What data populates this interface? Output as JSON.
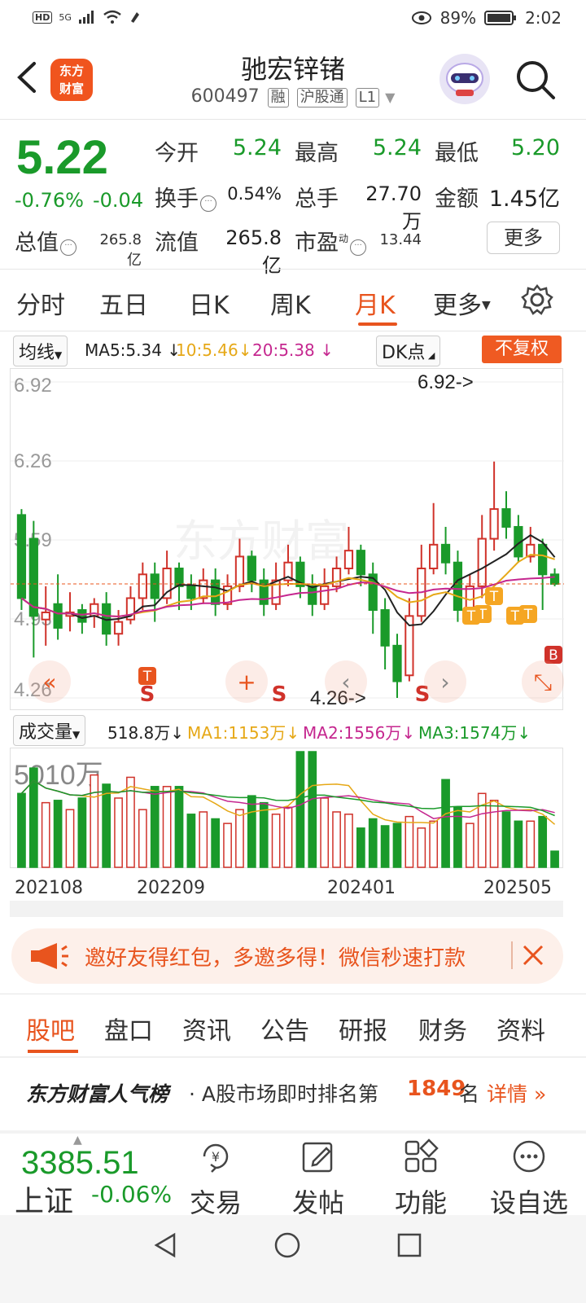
{
  "status": {
    "hd": "HD",
    "net": "5G",
    "battery": "89%",
    "time": "2:02"
  },
  "header": {
    "title": "驰宏锌锗",
    "code": "600497",
    "tags": [
      "融",
      "沪股通",
      "L1"
    ],
    "logo": "东方财富"
  },
  "quote": {
    "price": "5.22",
    "change_pct": "-0.76%",
    "change": "-0.04",
    "open_label": "今开",
    "open": "5.24",
    "high_label": "最高",
    "high": "5.24",
    "low_label": "最低",
    "low": "5.20",
    "turnover_label": "换手",
    "turnover": "0.54%",
    "volume_label": "总手",
    "volume": "27.70万",
    "amount_label": "金额",
    "amount": "1.45亿",
    "mktcap_label": "总值",
    "mktcap": "265.8亿",
    "float_label": "流值",
    "float_cap": "265.8亿",
    "pe_label": "市盈",
    "pe_sup": "动",
    "pe": "13.44",
    "more_button": "更多"
  },
  "tabs": [
    {
      "label": "分时"
    },
    {
      "label": "五日"
    },
    {
      "label": "日K"
    },
    {
      "label": "周K"
    },
    {
      "label": "月K",
      "active": true
    },
    {
      "label": "更多"
    }
  ],
  "ma_row": {
    "select": "均线",
    "ma5": "MA5:5.34",
    "ma10": "10:5.46",
    "ma20": "20:5.38",
    "dk": "DK点",
    "fuquan": "不复权"
  },
  "kchart": {
    "y_labels": [
      "6.92",
      "6.26",
      "5.59",
      "4.93",
      "4.26"
    ],
    "high_annot": "6.92->",
    "low_annot": "4.26->",
    "signals": {
      "t": "T",
      "s": "S",
      "b": "B"
    }
  },
  "vol_row": {
    "select": "成交量",
    "vol": "518.8万",
    "ma1": "MA1:1153万",
    "ma2": "MA2:1556万",
    "ma3": "MA3:1574万",
    "max_label": "5010万"
  },
  "x_labels": [
    "202108",
    "202209",
    "202401",
    "202505"
  ],
  "colors": {
    "up": "#d0322a",
    "down": "#1a9a2a",
    "accent": "#e8541e"
  },
  "chart_data": {
    "type": "candlestick",
    "ylim": [
      4.26,
      6.92
    ],
    "candles": [
      [
        5.8,
        5.1,
        5.85,
        5.0
      ],
      [
        5.6,
        4.95,
        5.75,
        4.6
      ],
      [
        4.92,
        4.98,
        5.2,
        4.7
      ],
      [
        5.05,
        4.85,
        5.3,
        4.75
      ],
      [
        4.95,
        4.98,
        5.15,
        4.82
      ],
      [
        5.0,
        4.9,
        5.05,
        4.8
      ],
      [
        4.95,
        5.05,
        5.1,
        4.85
      ],
      [
        5.05,
        4.8,
        5.15,
        4.7
      ],
      [
        4.8,
        4.9,
        5.0,
        4.7
      ],
      [
        4.92,
        5.1,
        5.2,
        4.88
      ],
      [
        5.1,
        5.3,
        5.4,
        5.0
      ],
      [
        5.3,
        5.1,
        5.4,
        4.9
      ],
      [
        5.1,
        5.35,
        5.5,
        5.05
      ],
      [
        5.35,
        5.2,
        5.4,
        5.0
      ],
      [
        5.2,
        5.1,
        5.3,
        5.0
      ],
      [
        5.1,
        5.25,
        5.35,
        5.05
      ],
      [
        5.25,
        5.05,
        5.35,
        4.95
      ],
      [
        5.05,
        5.2,
        5.3,
        5.0
      ],
      [
        5.2,
        5.45,
        5.6,
        5.15
      ],
      [
        5.45,
        5.25,
        5.5,
        5.15
      ],
      [
        5.25,
        5.05,
        5.35,
        4.95
      ],
      [
        5.05,
        5.25,
        5.4,
        5.0
      ],
      [
        5.25,
        5.4,
        5.55,
        5.2
      ],
      [
        5.4,
        5.2,
        5.45,
        5.1
      ],
      [
        5.2,
        5.05,
        5.3,
        4.95
      ],
      [
        5.05,
        5.2,
        5.35,
        5.0
      ],
      [
        5.2,
        5.35,
        5.45,
        5.15
      ],
      [
        5.35,
        5.5,
        5.7,
        5.3
      ],
      [
        5.5,
        5.3,
        5.55,
        5.2
      ],
      [
        5.3,
        5.0,
        5.4,
        4.8
      ],
      [
        5.0,
        4.7,
        5.1,
        4.5
      ],
      [
        4.7,
        4.4,
        4.8,
        4.26
      ],
      [
        4.45,
        4.95,
        5.1,
        4.4
      ],
      [
        4.95,
        5.35,
        5.55,
        4.9
      ],
      [
        5.35,
        5.55,
        5.9,
        5.3
      ],
      [
        5.55,
        5.4,
        5.7,
        5.3
      ],
      [
        5.4,
        5.0,
        5.5,
        4.9
      ],
      [
        5.0,
        5.2,
        5.3,
        4.9
      ],
      [
        5.2,
        5.6,
        5.8,
        5.1
      ],
      [
        5.6,
        5.85,
        6.25,
        5.5
      ],
      [
        5.85,
        5.7,
        6.0,
        5.6
      ],
      [
        5.7,
        5.45,
        5.8,
        5.4
      ],
      [
        5.45,
        5.55,
        5.7,
        5.4
      ],
      [
        5.55,
        5.3,
        5.6,
        5.0
      ],
      [
        5.3,
        5.22,
        5.35,
        5.2
      ]
    ],
    "volume_max": 5010,
    "volumes": [
      3200,
      4300,
      2800,
      2900,
      2500,
      3000,
      4000,
      3600,
      3000,
      3900,
      2500,
      3500,
      3500,
      3500,
      2300,
      2400,
      2100,
      1900,
      2500,
      3100,
      2800,
      2300,
      2600,
      5010,
      5010,
      3000,
      2400,
      2300,
      1700,
      2100,
      1800,
      1900,
      2200,
      1700,
      2000,
      3800,
      2600,
      1900,
      3200,
      2900,
      2400,
      2000,
      2000,
      2200,
      700
    ]
  },
  "promo": {
    "text": "邀好友得红包，多邀多得！微信秒速打款"
  },
  "bottom_tabs": [
    {
      "label": "股吧",
      "active": true
    },
    {
      "label": "盘口"
    },
    {
      "label": "资讯"
    },
    {
      "label": "公告"
    },
    {
      "label": "研报"
    },
    {
      "label": "财务"
    },
    {
      "label": "资料"
    }
  ],
  "rank": {
    "brand": "东方财富人气榜",
    "prefix": "· A股市场即时排名第",
    "rank": "1849",
    "suffix": "名",
    "detail": "详情"
  },
  "footer": {
    "index_value": "3385.51",
    "index_name": "上证",
    "index_change": "-0.06%",
    "nav": [
      {
        "label": "交易"
      },
      {
        "label": "发帖"
      },
      {
        "label": "功能"
      },
      {
        "label": "设自选"
      }
    ]
  }
}
